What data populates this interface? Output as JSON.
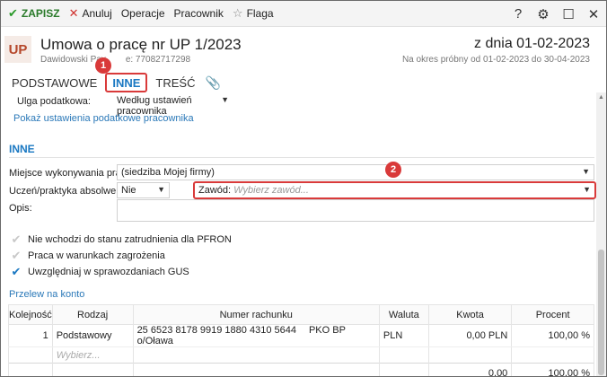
{
  "toolbar": {
    "save": "ZAPISZ",
    "cancel": "Anuluj",
    "operations": "Operacje",
    "employee": "Pracownik",
    "flag": "Flaga"
  },
  "header": {
    "logo": "UP",
    "title": "Umowa o pracę nr UP 1/2023",
    "subtitle": "Dawidowski Pav",
    "subtitle_tail": "e: 77082717298",
    "date": "z dnia 01-02-2023",
    "period": "Na okres próbny od 01-02-2023 do 30-04-2023"
  },
  "tabs": [
    {
      "label": "PODSTAWOWE"
    },
    {
      "label": "INNE"
    },
    {
      "label": "TREŚĆ"
    }
  ],
  "badges": {
    "one": "1",
    "two": "2"
  },
  "tax": {
    "label": "Ulga podatkowa:",
    "value": "Według ustawień pracownika",
    "link": "Pokaż ustawienia podatkowe pracownika"
  },
  "section": {
    "title": "INNE"
  },
  "form": {
    "place_label": "Miejsce wykonywania pracy:",
    "place_value": "(siedziba Mojej firmy)",
    "student_label": "Uczeń/praktyka absolwencka:",
    "student_value": "Nie",
    "job_label": "Zawód:",
    "job_placeholder": "Wybierz zawód...",
    "desc_label": "Opis:"
  },
  "checkboxes": [
    {
      "label": "Nie wchodzi do stanu zatrudnienia dla PFRON",
      "checked": false
    },
    {
      "label": "Praca w warunkach zagrożenia",
      "checked": false
    },
    {
      "label": "Uwzględniaj w sprawozdaniach GUS",
      "checked": true
    }
  ],
  "transfer": {
    "title": "Przelew na konto",
    "columns": [
      "Kolejność",
      "Rodzaj",
      "Numer rachunku",
      "Waluta",
      "Kwota",
      "Procent"
    ],
    "rows": [
      {
        "order": "1",
        "type": "Podstawowy",
        "account": "25 6523 8178 9919 1880 4310 5644",
        "bank": "PKO BP o/Oława",
        "currency": "PLN",
        "amount": "0,00 PLN",
        "percent": "100,00 %"
      }
    ],
    "new_placeholder": "Wybierz...",
    "total_amount": "0,00",
    "total_percent": "100,00 %"
  }
}
